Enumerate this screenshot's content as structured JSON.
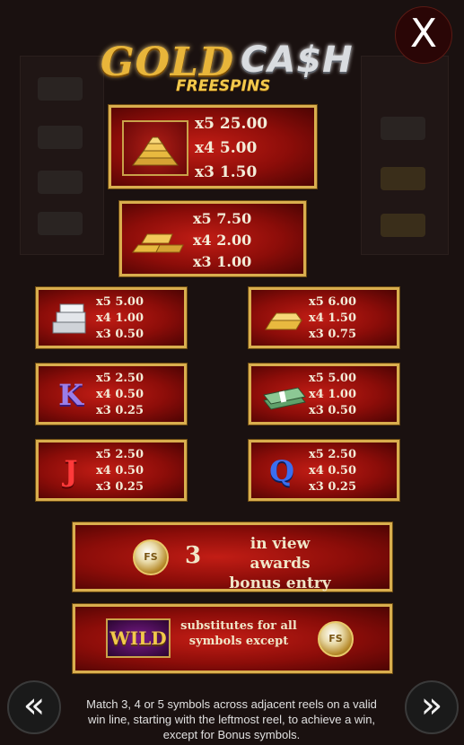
{
  "header": {
    "logo_gold": "GOLD",
    "logo_cash": "CA$H",
    "logo_sub": "FREESPINS",
    "close_label": "X"
  },
  "paytable": [
    {
      "symbol": "gold-bars-stack",
      "pays": [
        "x5 25.00",
        "x4 5.00",
        "x3 1.50"
      ]
    },
    {
      "symbol": "gold-bars",
      "pays": [
        "x5 7.50",
        "x4 2.00",
        "x3 1.00"
      ]
    },
    {
      "symbol": "silver-bars",
      "pays": [
        "x5 5.00",
        "x4 1.00",
        "x3 0.50"
      ]
    },
    {
      "symbol": "gold-bar",
      "pays": [
        "x5 6.00",
        "x4 1.50",
        "x3 0.75"
      ]
    },
    {
      "symbol": "letter-k",
      "letter": "K",
      "pays": [
        "x5 2.50",
        "x4 0.50",
        "x3 0.25"
      ]
    },
    {
      "symbol": "cash-bundle",
      "pays": [
        "x5 5.00",
        "x4 1.00",
        "x3 0.50"
      ]
    },
    {
      "symbol": "letter-j",
      "letter": "J",
      "pays": [
        "x5 2.50",
        "x4 0.50",
        "x3 0.25"
      ]
    },
    {
      "symbol": "letter-q",
      "letter": "Q",
      "pays": [
        "x5 2.50",
        "x4 0.50",
        "x3 0.25"
      ]
    }
  ],
  "bonus": {
    "coin_label": "FS",
    "count": "3",
    "text_line1": "in view awards",
    "text_line2": "bonus entry"
  },
  "wild": {
    "badge": "WILD",
    "text_line1": "substitutes for all",
    "text_line2": "symbols except",
    "coin_label": "FS"
  },
  "nav": {
    "prev_label": "«",
    "next_label": "»"
  },
  "footer_text": "Match 3, 4 or 5 symbols across adjacent reels on a valid win line, starting with the leftmost reel, to achieve a win, except for Bonus symbols.",
  "colors": {
    "panel_border": "#d9ae4e",
    "panel_red": "#c21d15",
    "text": "#f3ecd8"
  }
}
